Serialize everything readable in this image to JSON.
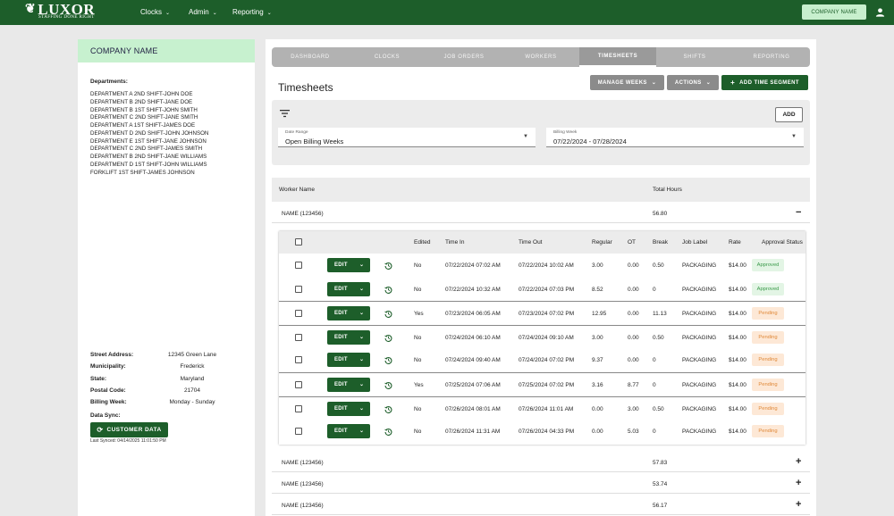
{
  "header": {
    "logo_text": "LUXOR",
    "logo_tagline": "STAFFING DONE RIGHT",
    "nav": [
      {
        "label": "Clocks"
      },
      {
        "label": "Admin"
      },
      {
        "label": "Reporting"
      }
    ],
    "company_button": "COMPANY NAME"
  },
  "sidebar": {
    "company_name": "COMPANY NAME",
    "departments_title": "Departments:",
    "departments": [
      "DEPARTMENT A 2ND SHIFT-JOHN DOE",
      "DEPARTMENT B 2ND SHIFT-JANE DOE",
      "DEPARTMENT B 1ST SHIFT-JOHN SMITH",
      "DEPARTMENT C 2ND SHIFT-JANE SMITH",
      "DEPARTMENT A 1ST SHIFT-JAMES DOE",
      "DEPARTMENT D 2ND SHIFT-JOHN JOHNSON",
      "DEPARTMENT E 1ST SHIFT-JANE JOHNSON",
      "DEPARTMENT C 2ND SHIFT-JAMES SMITH",
      "DEPARTMENT B 2ND SHIFT-JANE WILLIAMS",
      "DEPARTMENT D 1ST SHIFT-JOHN WILLIAMS",
      "FORKLIFT 1ST SHIFT-JAMES JOHNSON"
    ],
    "address": [
      {
        "key": "Street Address:",
        "value": "12345 Green Lane"
      },
      {
        "key": "Municipality:",
        "value": "Frederick"
      },
      {
        "key": "State:",
        "value": "Maryland"
      },
      {
        "key": "Postal Code:",
        "value": "21704"
      },
      {
        "key": "Billing Week:",
        "value": "Monday - Sunday"
      }
    ],
    "sync_label": "Data Sync:",
    "sync_button": "CUSTOMER DATA",
    "last_synced": "Last Synced: 04/14/2025 11:01:50 PM"
  },
  "tabs": [
    {
      "label": "DASHBOARD",
      "active": false
    },
    {
      "label": "CLOCKS",
      "active": false
    },
    {
      "label": "JOB ORDERS",
      "active": false
    },
    {
      "label": "WORKERS",
      "active": false
    },
    {
      "label": "TIMESHEETS",
      "active": true
    },
    {
      "label": "SHIFTS",
      "active": false
    },
    {
      "label": "REPORTING",
      "active": false
    }
  ],
  "page": {
    "title": "Timesheets",
    "manage_weeks": "MANAGE WEEKS",
    "actions": "ACTIONS",
    "add_time_segment": "ADD TIME SEGMENT"
  },
  "filters": {
    "add_button": "ADD",
    "date_range_label": "Date Range",
    "date_range_value": "Open Billing Weeks",
    "billing_week_label": "Billing Week",
    "billing_week_value": "07/22/2024 - 07/28/2024"
  },
  "table": {
    "col_worker": "Worker Name",
    "col_hours": "Total Hours",
    "workers": [
      {
        "name": "NAME (123456)",
        "hours": "56.80",
        "toggle": "−"
      },
      {
        "name": "NAME (123456)",
        "hours": "57.83",
        "toggle": "+"
      },
      {
        "name": "NAME (123456)",
        "hours": "53.74",
        "toggle": "+"
      },
      {
        "name": "NAME (123456)",
        "hours": "56.17",
        "toggle": "+"
      }
    ]
  },
  "detail": {
    "headers": {
      "edited": "Edited",
      "time_in": "Time In",
      "time_out": "Time Out",
      "regular": "Regular",
      "ot": "OT",
      "break": "Break",
      "job_label": "Job Label",
      "rate": "Rate",
      "status": "Approval Status"
    },
    "edit_label": "EDIT",
    "rows": [
      {
        "edited": "No",
        "time_in": "07/22/2024 07:02 AM",
        "time_out": "07/22/2024 10:02 AM",
        "regular": "3.00",
        "ot": "0.00",
        "break": "0.50",
        "job": "PACKAGING",
        "rate": "$14.00",
        "status": "Approved"
      },
      {
        "edited": "No",
        "time_in": "07/22/2024 10:32 AM",
        "time_out": "07/22/2024 07:03 PM",
        "regular": "8.52",
        "ot": "0.00",
        "break": "0",
        "job": "PACKAGING",
        "rate": "$14.00",
        "status": "Approved"
      },
      {
        "edited": "Yes",
        "time_in": "07/23/2024 06:05 AM",
        "time_out": "07/23/2024 07:02 PM",
        "regular": "12.95",
        "ot": "0.00",
        "break": "11.13",
        "job": "PACKAGING",
        "rate": "$14.00",
        "status": "Pending"
      },
      {
        "edited": "No",
        "time_in": "07/24/2024 06:10 AM",
        "time_out": "07/24/2024 09:10 AM",
        "regular": "3.00",
        "ot": "0.00",
        "break": "0.50",
        "job": "PACKAGING",
        "rate": "$14.00",
        "status": "Pending"
      },
      {
        "edited": "No",
        "time_in": "07/24/2024 09:40 AM",
        "time_out": "07/24/2024 07:02 PM",
        "regular": "9.37",
        "ot": "0.00",
        "break": "0",
        "job": "PACKAGING",
        "rate": "$14.00",
        "status": "Pending"
      },
      {
        "edited": "Yes",
        "time_in": "07/25/2024 07:06 AM",
        "time_out": "07/25/2024 07:02 PM",
        "regular": "3.16",
        "ot": "8.77",
        "break": "0",
        "job": "PACKAGING",
        "rate": "$14.00",
        "status": "Pending"
      },
      {
        "edited": "No",
        "time_in": "07/26/2024 08:01 AM",
        "time_out": "07/26/2024 11:01 AM",
        "regular": "0.00",
        "ot": "3.00",
        "break": "0.50",
        "job": "PACKAGING",
        "rate": "$14.00",
        "status": "Pending"
      },
      {
        "edited": "No",
        "time_in": "07/26/2024 11:31 AM",
        "time_out": "07/26/2024 04:33 PM",
        "regular": "0.00",
        "ot": "5.03",
        "break": "0",
        "job": "PACKAGING",
        "rate": "$14.00",
        "status": "Pending"
      }
    ]
  },
  "colors": {
    "brand": "#1d5e2a",
    "accent_light": "#c7efcd",
    "approved": "#3a9a4a",
    "pending": "#e08a3a"
  }
}
